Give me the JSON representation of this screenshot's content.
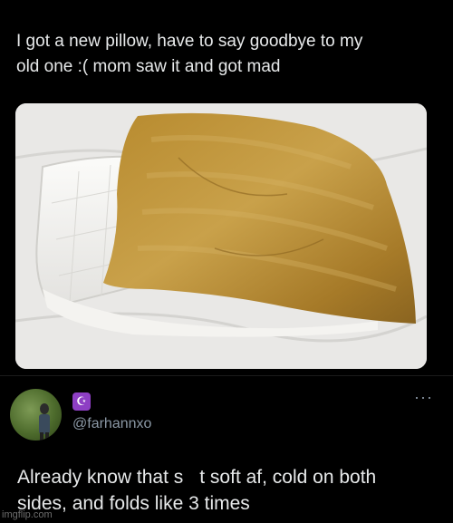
{
  "post": {
    "text": "I got a new pillow, have to say goodbye to my\nold one :( mom saw it and got mad"
  },
  "reply": {
    "badge_icon": "star-and-crescent-icon",
    "handle": "@farhannxo",
    "more_icon": "more-options-icon",
    "text_part1": "Already know that s",
    "text_part2": "t soft af, cold on both\nsides, and folds like 3 times"
  },
  "watermark": "imgflip.com",
  "colors": {
    "background": "#000000",
    "text": "#e7e9ea",
    "secondary_text": "#8b98a5",
    "badge": "#8e3fc4"
  }
}
